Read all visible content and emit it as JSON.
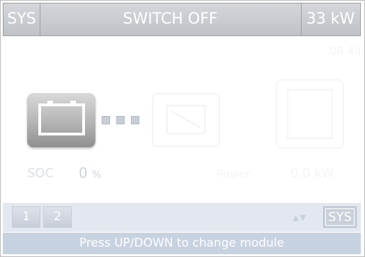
{
  "header": {
    "sys_label": "SYS",
    "status": "SWITCH OFF",
    "power": "33 kW"
  },
  "corner_code": "08 44",
  "battery": {
    "soc_label": "SOC",
    "soc_value": "0",
    "soc_unit": "%"
  },
  "power_readout": {
    "label": "Power",
    "value": "0.0 kW"
  },
  "bottom": {
    "module_buttons": [
      "1",
      "2"
    ],
    "arrows": "▲▼",
    "sys_button": "SYS"
  },
  "hint": "Press UP/DOWN to change module"
}
